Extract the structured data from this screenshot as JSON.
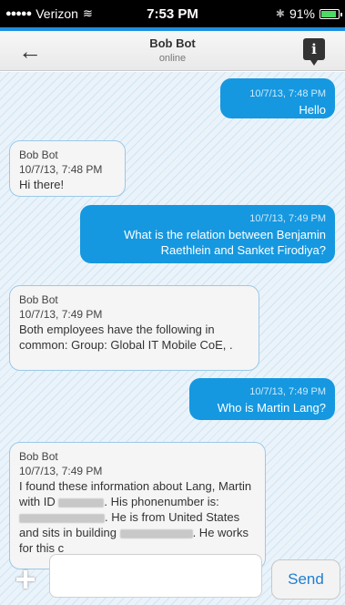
{
  "status_bar": {
    "carrier": "Verizon",
    "signal": "●●●●●",
    "time": "7:53 PM",
    "battery": "91%",
    "battery_level": 0.91
  },
  "nav": {
    "back_icon": "←",
    "title": "Bob Bot",
    "subtitle": "online",
    "info_icon": "i"
  },
  "messages": [
    {
      "direction": "out",
      "timestamp": "10/7/13, 7:48 PM",
      "text": "Hello"
    },
    {
      "direction": "in",
      "sender": "Bob Bot",
      "timestamp": "10/7/13, 7:48 PM",
      "text": "Hi there!"
    },
    {
      "direction": "out",
      "timestamp": "10/7/13, 7:49 PM",
      "text": "What is the relation between Benjamin Raethlein and Sanket Firodiya?"
    },
    {
      "direction": "in",
      "sender": "Bob Bot",
      "timestamp": "10/7/13, 7:49 PM",
      "text": "Both employees have the following in common:  Group: Global IT Mobile CoE, ."
    },
    {
      "direction": "out",
      "timestamp": "10/7/13, 7:49 PM",
      "text": "Who is Martin Lang?"
    },
    {
      "direction": "in",
      "sender": "Bob Bot",
      "timestamp": "10/7/13, 7:49 PM",
      "text_parts": [
        "I found these information about Lang, Martin with ID ",
        ". His phonenumber is: ",
        ". He is from United States and sits in building ",
        ". He works for this c"
      ]
    }
  ],
  "input": {
    "add_icon": "+",
    "placeholder": "",
    "value": "",
    "send_label": "Send"
  }
}
